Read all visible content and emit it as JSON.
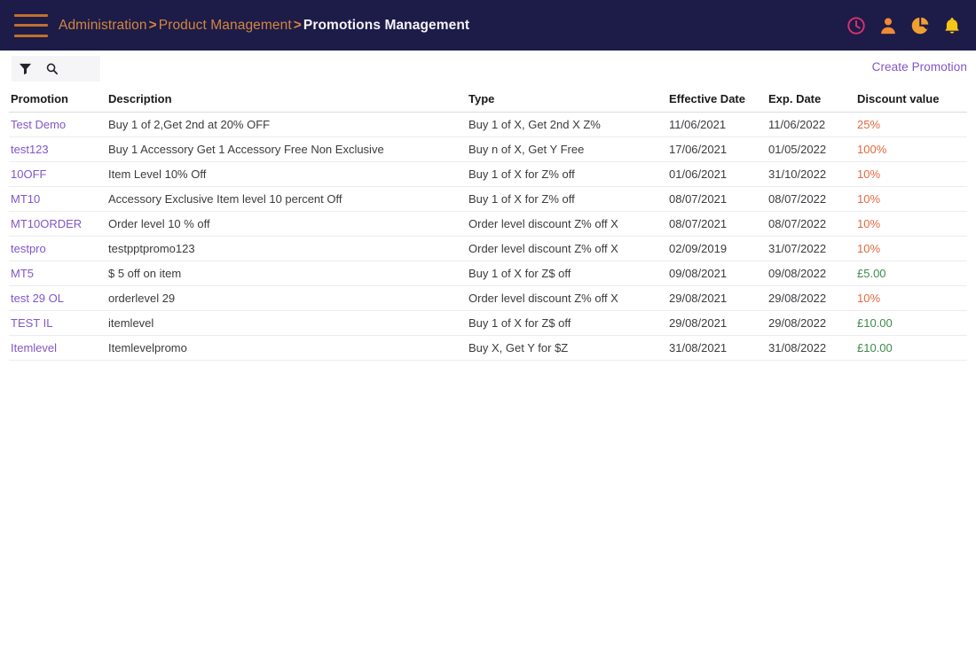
{
  "header": {
    "menu_icon": "hamburger-menu-icon",
    "breadcrumb": {
      "items": [
        "Administration",
        "Product Management",
        "Promotions Management"
      ],
      "separator": ">"
    },
    "icons": [
      {
        "name": "clock-icon",
        "color": "#d6336c"
      },
      {
        "name": "user-icon",
        "color": "#f08a33"
      },
      {
        "name": "pie-chart-icon",
        "color": "#f0a030"
      },
      {
        "name": "bell-icon",
        "color": "#f5c518"
      }
    ],
    "background_color": "#1d1b48",
    "link_color": "#d2873e",
    "current_color": "#f4f4f8"
  },
  "toolbar": {
    "filter_icon": "filter-funnel-icon",
    "search_icon": "search-icon",
    "create_label": "Create Promotion",
    "create_color": "#8256c8"
  },
  "table": {
    "columns": [
      "Promotion",
      "Description",
      "Type",
      "Effective Date",
      "Exp. Date",
      "Discount value"
    ],
    "rows": [
      {
        "promotion": "Test Demo",
        "description": "Buy 1 of 2,Get 2nd at 20% OFF",
        "type": "Buy 1 of X, Get 2nd X Z%",
        "effective_date": "11/06/2021",
        "exp_date": "11/06/2022",
        "discount": "25%",
        "discount_kind": "percent"
      },
      {
        "promotion": "test123",
        "description": "Buy 1 Accessory Get 1 Accessory Free Non Exclusive",
        "type": "Buy n of X, Get Y Free",
        "effective_date": "17/06/2021",
        "exp_date": "01/05/2022",
        "discount": "100%",
        "discount_kind": "percent"
      },
      {
        "promotion": "10OFF",
        "description": "Item Level 10% Off",
        "type": "Buy 1 of X for Z% off",
        "effective_date": "01/06/2021",
        "exp_date": "31/10/2022",
        "discount": "10%",
        "discount_kind": "percent"
      },
      {
        "promotion": "MT10",
        "description": "Accessory Exclusive Item level 10 percent Off",
        "type": "Buy 1 of X for Z% off",
        "effective_date": "08/07/2021",
        "exp_date": "08/07/2022",
        "discount": "10%",
        "discount_kind": "percent"
      },
      {
        "promotion": "MT10ORDER",
        "description": "Order level 10 % off",
        "type": "Order level discount Z% off X",
        "effective_date": "08/07/2021",
        "exp_date": "08/07/2022",
        "discount": "10%",
        "discount_kind": "percent"
      },
      {
        "promotion": "testpro",
        "description": "testpptpromo123",
        "type": "Order level discount Z% off X",
        "effective_date": "02/09/2019",
        "exp_date": "31/07/2022",
        "discount": "10%",
        "discount_kind": "percent"
      },
      {
        "promotion": "MT5",
        "description": "$ 5 off on item",
        "type": "Buy 1 of X for Z$ off",
        "effective_date": "09/08/2021",
        "exp_date": "09/08/2022",
        "discount": "£5.00",
        "discount_kind": "currency"
      },
      {
        "promotion": "test 29 OL",
        "description": "orderlevel 29",
        "type": "Order level discount Z% off X",
        "effective_date": "29/08/2021",
        "exp_date": "29/08/2022",
        "discount": "10%",
        "discount_kind": "percent"
      },
      {
        "promotion": "TEST IL",
        "description": "itemlevel",
        "type": "Buy 1 of X for Z$ off",
        "effective_date": "29/08/2021",
        "exp_date": "29/08/2022",
        "discount": "£10.00",
        "discount_kind": "currency"
      },
      {
        "promotion": "Itemlevel",
        "description": "Itemlevelpromo",
        "type": "Buy X, Get Y for $Z",
        "effective_date": "31/08/2021",
        "exp_date": "31/08/2022",
        "discount": "£10.00",
        "discount_kind": "currency"
      }
    ]
  }
}
